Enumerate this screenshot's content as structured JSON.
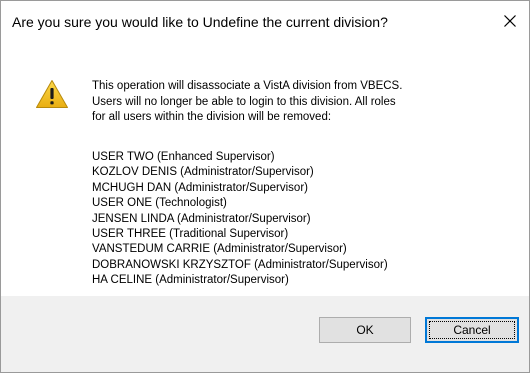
{
  "dialog": {
    "title": "Are you sure you would like to Undefine the current division?",
    "close_icon": "close-icon",
    "warning_icon": "warning-icon",
    "colors": {
      "warning_fill": "#f3c31c",
      "footer_bg": "#f0f0f0",
      "focus_border": "#0078d7"
    }
  },
  "message": {
    "lines": [
      "This operation will disassociate a VistA division from VBECS.",
      "Users will no longer be able to login to this division. All roles",
      "for all users within the division will be removed:"
    ]
  },
  "users": [
    "USER TWO (Enhanced Supervisor)",
    "KOZLOV DENIS (Administrator/Supervisor)",
    "MCHUGH DAN (Administrator/Supervisor)",
    "USER ONE (Technologist)",
    "JENSEN LINDA (Administrator/Supervisor)",
    "USER THREE (Traditional Supervisor)",
    "VANSTEDUM CARRIE (Administrator/Supervisor)",
    "DOBRANOWSKI KRZYSZTOF (Administrator/Supervisor)",
    "HA CELINE (Administrator/Supervisor)"
  ],
  "buttons": {
    "ok_label": "OK",
    "cancel_label": "Cancel",
    "focused": "cancel"
  }
}
